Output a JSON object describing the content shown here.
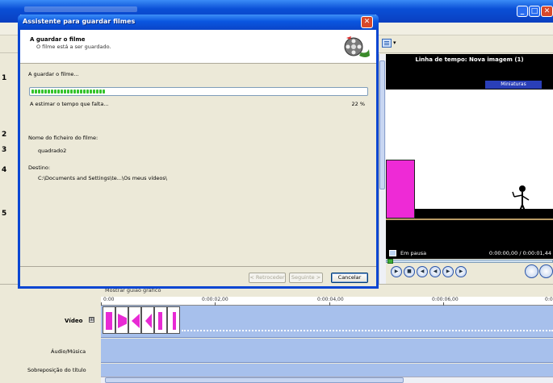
{
  "dialog": {
    "title": "Assistente para guardar filmes",
    "close_glyph": "✕",
    "header_title": "A guardar o filme",
    "header_subtitle": "O filme está a ser guardado.",
    "saving_label": "A guardar o filme...",
    "progress_percent": 22,
    "estimating_label": "A estimar o tempo que falta...",
    "percent_label": "22 %",
    "filename_label": "Nome do ficheiro do filme:",
    "filename_value": "quadrado2",
    "destination_label": "Destino:",
    "destination_value": "C:\\Documents and Settings\\te...\\Os meus vídeos\\",
    "buttons": {
      "back": "< Retroceder",
      "next": "Seguinte >",
      "cancel": "Cancelar"
    },
    "header_icon": "film-reel-icon"
  },
  "background": {
    "window_controls": [
      "_",
      "□",
      "✕"
    ],
    "side_numbers": [
      "1",
      "2",
      "3",
      "4",
      "5"
    ],
    "preview": {
      "title": "Linha de tempo: Nova imagem (1)",
      "thumbnails_label": "Miniaturas",
      "status": "Em pausa",
      "time": "0:00:00,00 / 0:00:01,44"
    },
    "timeline": {
      "toolbar_label": "Mostrar guião gráfico",
      "ticks": [
        "0:00",
        "0:00:02,00",
        "0:00:04,00",
        "0:00:06,00",
        "0:0"
      ],
      "tracks": {
        "video": "Vídeo",
        "audio": "Áudio/Música",
        "title_overlay": "Sobreposição do título"
      },
      "expand_glyph": "⊞"
    }
  },
  "colors": {
    "titlebar": "#0a4fd6",
    "progress": "#35c42c",
    "pink": "#ee2ad6",
    "timeline": "#a7c0ec"
  }
}
